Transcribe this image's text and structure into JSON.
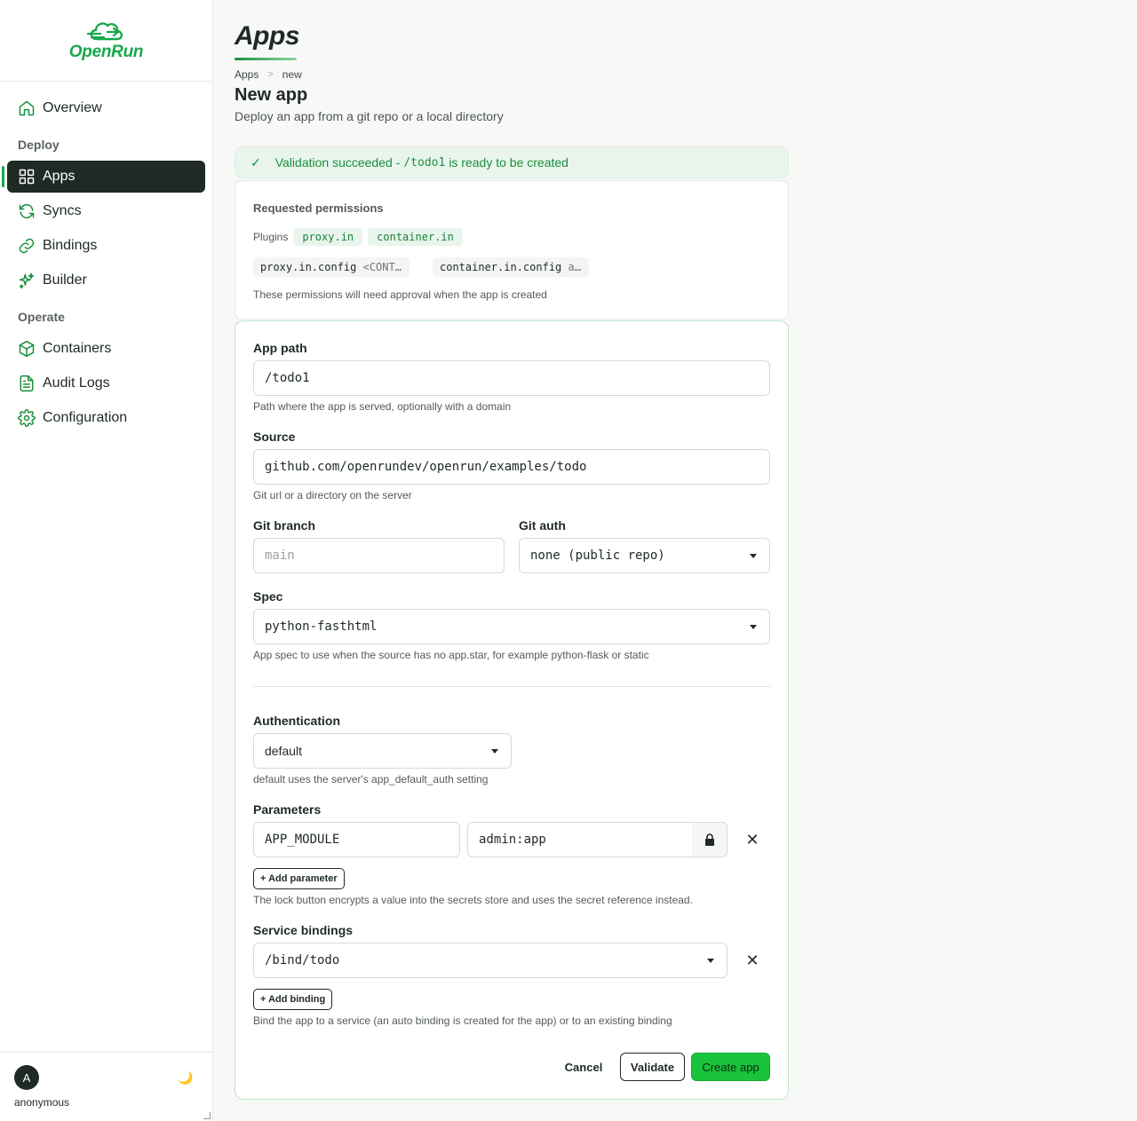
{
  "brand": {
    "name": "OpenRun",
    "color": "#17a84a"
  },
  "sidebar": {
    "overview": "Overview",
    "section_deploy": "Deploy",
    "apps": "Apps",
    "syncs": "Syncs",
    "bindings": "Bindings",
    "builder": "Builder",
    "section_operate": "Operate",
    "containers": "Containers",
    "audit_logs": "Audit Logs",
    "configuration": "Configuration"
  },
  "user": {
    "avatar_letter": "A",
    "name": "anonymous"
  },
  "header": {
    "title": "Apps",
    "breadcrumb": [
      "Apps",
      "new"
    ],
    "heading": "New app",
    "subtitle": "Deploy an app from a git repo or a local directory"
  },
  "alert": {
    "prefix": "Validation succeeded -",
    "path": "/todo1",
    "suffix": "is ready to be created"
  },
  "permissions": {
    "title": "Requested permissions",
    "plugins_label": "Plugins",
    "plugins": [
      "proxy.in",
      "container.in"
    ],
    "configs": [
      {
        "key": "proxy.in.config",
        "value": "<CONT…"
      },
      {
        "key": "container.in.config",
        "value": "a…"
      }
    ],
    "note": "These permissions will need approval when the app is created"
  },
  "form": {
    "app_path": {
      "label": "App path",
      "value": "/todo1",
      "hint": "Path where the app is served, optionally with a domain"
    },
    "source": {
      "label": "Source",
      "value": "github.com/openrundev/openrun/examples/todo",
      "hint": "Git url or a directory on the server"
    },
    "git_branch": {
      "label": "Git branch",
      "placeholder": "main"
    },
    "git_auth": {
      "label": "Git auth",
      "value": "none (public repo)"
    },
    "spec": {
      "label": "Spec",
      "value": "python-fasthtml",
      "hint": "App spec to use when the source has no app.star, for example python-flask or static"
    },
    "authentication": {
      "label": "Authentication",
      "value": "default",
      "hint": "default uses the server's app_default_auth setting"
    },
    "parameters": {
      "label": "Parameters",
      "items": [
        {
          "key": "APP_MODULE",
          "value": "admin:app"
        }
      ],
      "add_label": "+ Add parameter",
      "hint": "The lock button encrypts a value into the secrets store and uses the secret reference instead."
    },
    "bindings": {
      "label": "Service bindings",
      "items": [
        "/bind/todo"
      ],
      "add_label": "+ Add binding",
      "hint": "Bind the app to a service (an auto binding is created for the app) or to an existing binding"
    },
    "buttons": {
      "cancel": "Cancel",
      "validate": "Validate",
      "create": "Create app"
    }
  }
}
